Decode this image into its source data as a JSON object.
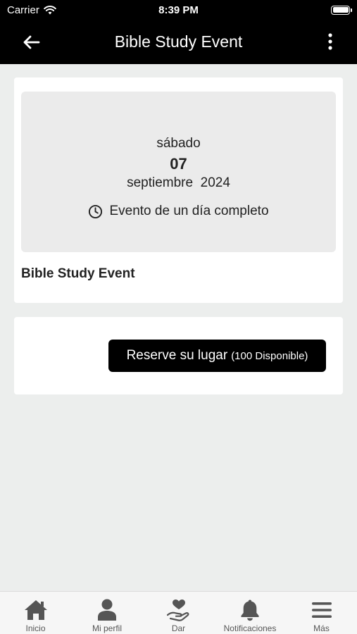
{
  "status_bar": {
    "carrier": "Carrier",
    "time": "8:39 PM"
  },
  "nav": {
    "title": "Bible Study Event",
    "back_icon": "arrow-left-icon",
    "more_icon": "vertical-ellipsis-icon"
  },
  "event": {
    "weekday": "sábado",
    "day": "07",
    "month_year": "septiembre  2024",
    "all_day_label": "Evento de un día completo",
    "title": "Bible Study Event"
  },
  "reserve": {
    "label": "Reserve su lugar",
    "availability": "(100 Disponible)"
  },
  "tabs": [
    {
      "label": "Inicio",
      "icon": "home-icon"
    },
    {
      "label": "Mi perfil",
      "icon": "person-icon"
    },
    {
      "label": "Dar",
      "icon": "heart-hand-icon"
    },
    {
      "label": "Notificaciones",
      "icon": "bell-icon"
    },
    {
      "label": "Más",
      "icon": "menu-icon"
    }
  ],
  "colors": {
    "header": "#000000",
    "background": "#eceeed",
    "card": "#ffffff",
    "date_box": "#ebebeb",
    "tab_icon": "#555555"
  }
}
